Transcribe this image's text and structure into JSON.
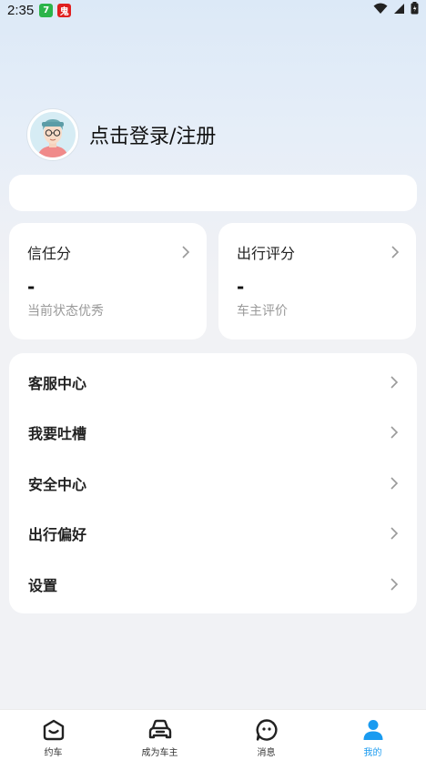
{
  "status_bar": {
    "time": "2:35",
    "notif_green": "7",
    "notif_red": "鬼"
  },
  "profile": {
    "login_text": "点击登录/注册"
  },
  "cards": [
    {
      "title": "信任分",
      "value": "-",
      "sub": "当前状态优秀"
    },
    {
      "title": "出行评分",
      "value": "-",
      "sub": "车主评价"
    }
  ],
  "menu": [
    {
      "label": "客服中心"
    },
    {
      "label": "我要吐槽"
    },
    {
      "label": "安全中心"
    },
    {
      "label": "出行偏好"
    },
    {
      "label": "设置"
    }
  ],
  "tabs": [
    {
      "label": "约车",
      "icon": "home-icon",
      "active": false
    },
    {
      "label": "成为车主",
      "icon": "car-icon",
      "active": false
    },
    {
      "label": "消息",
      "icon": "message-icon",
      "active": false
    },
    {
      "label": "我的",
      "icon": "person-icon",
      "active": true
    }
  ],
  "colors": {
    "accent": "#1a9bf0",
    "background": "#f1f2f5"
  }
}
